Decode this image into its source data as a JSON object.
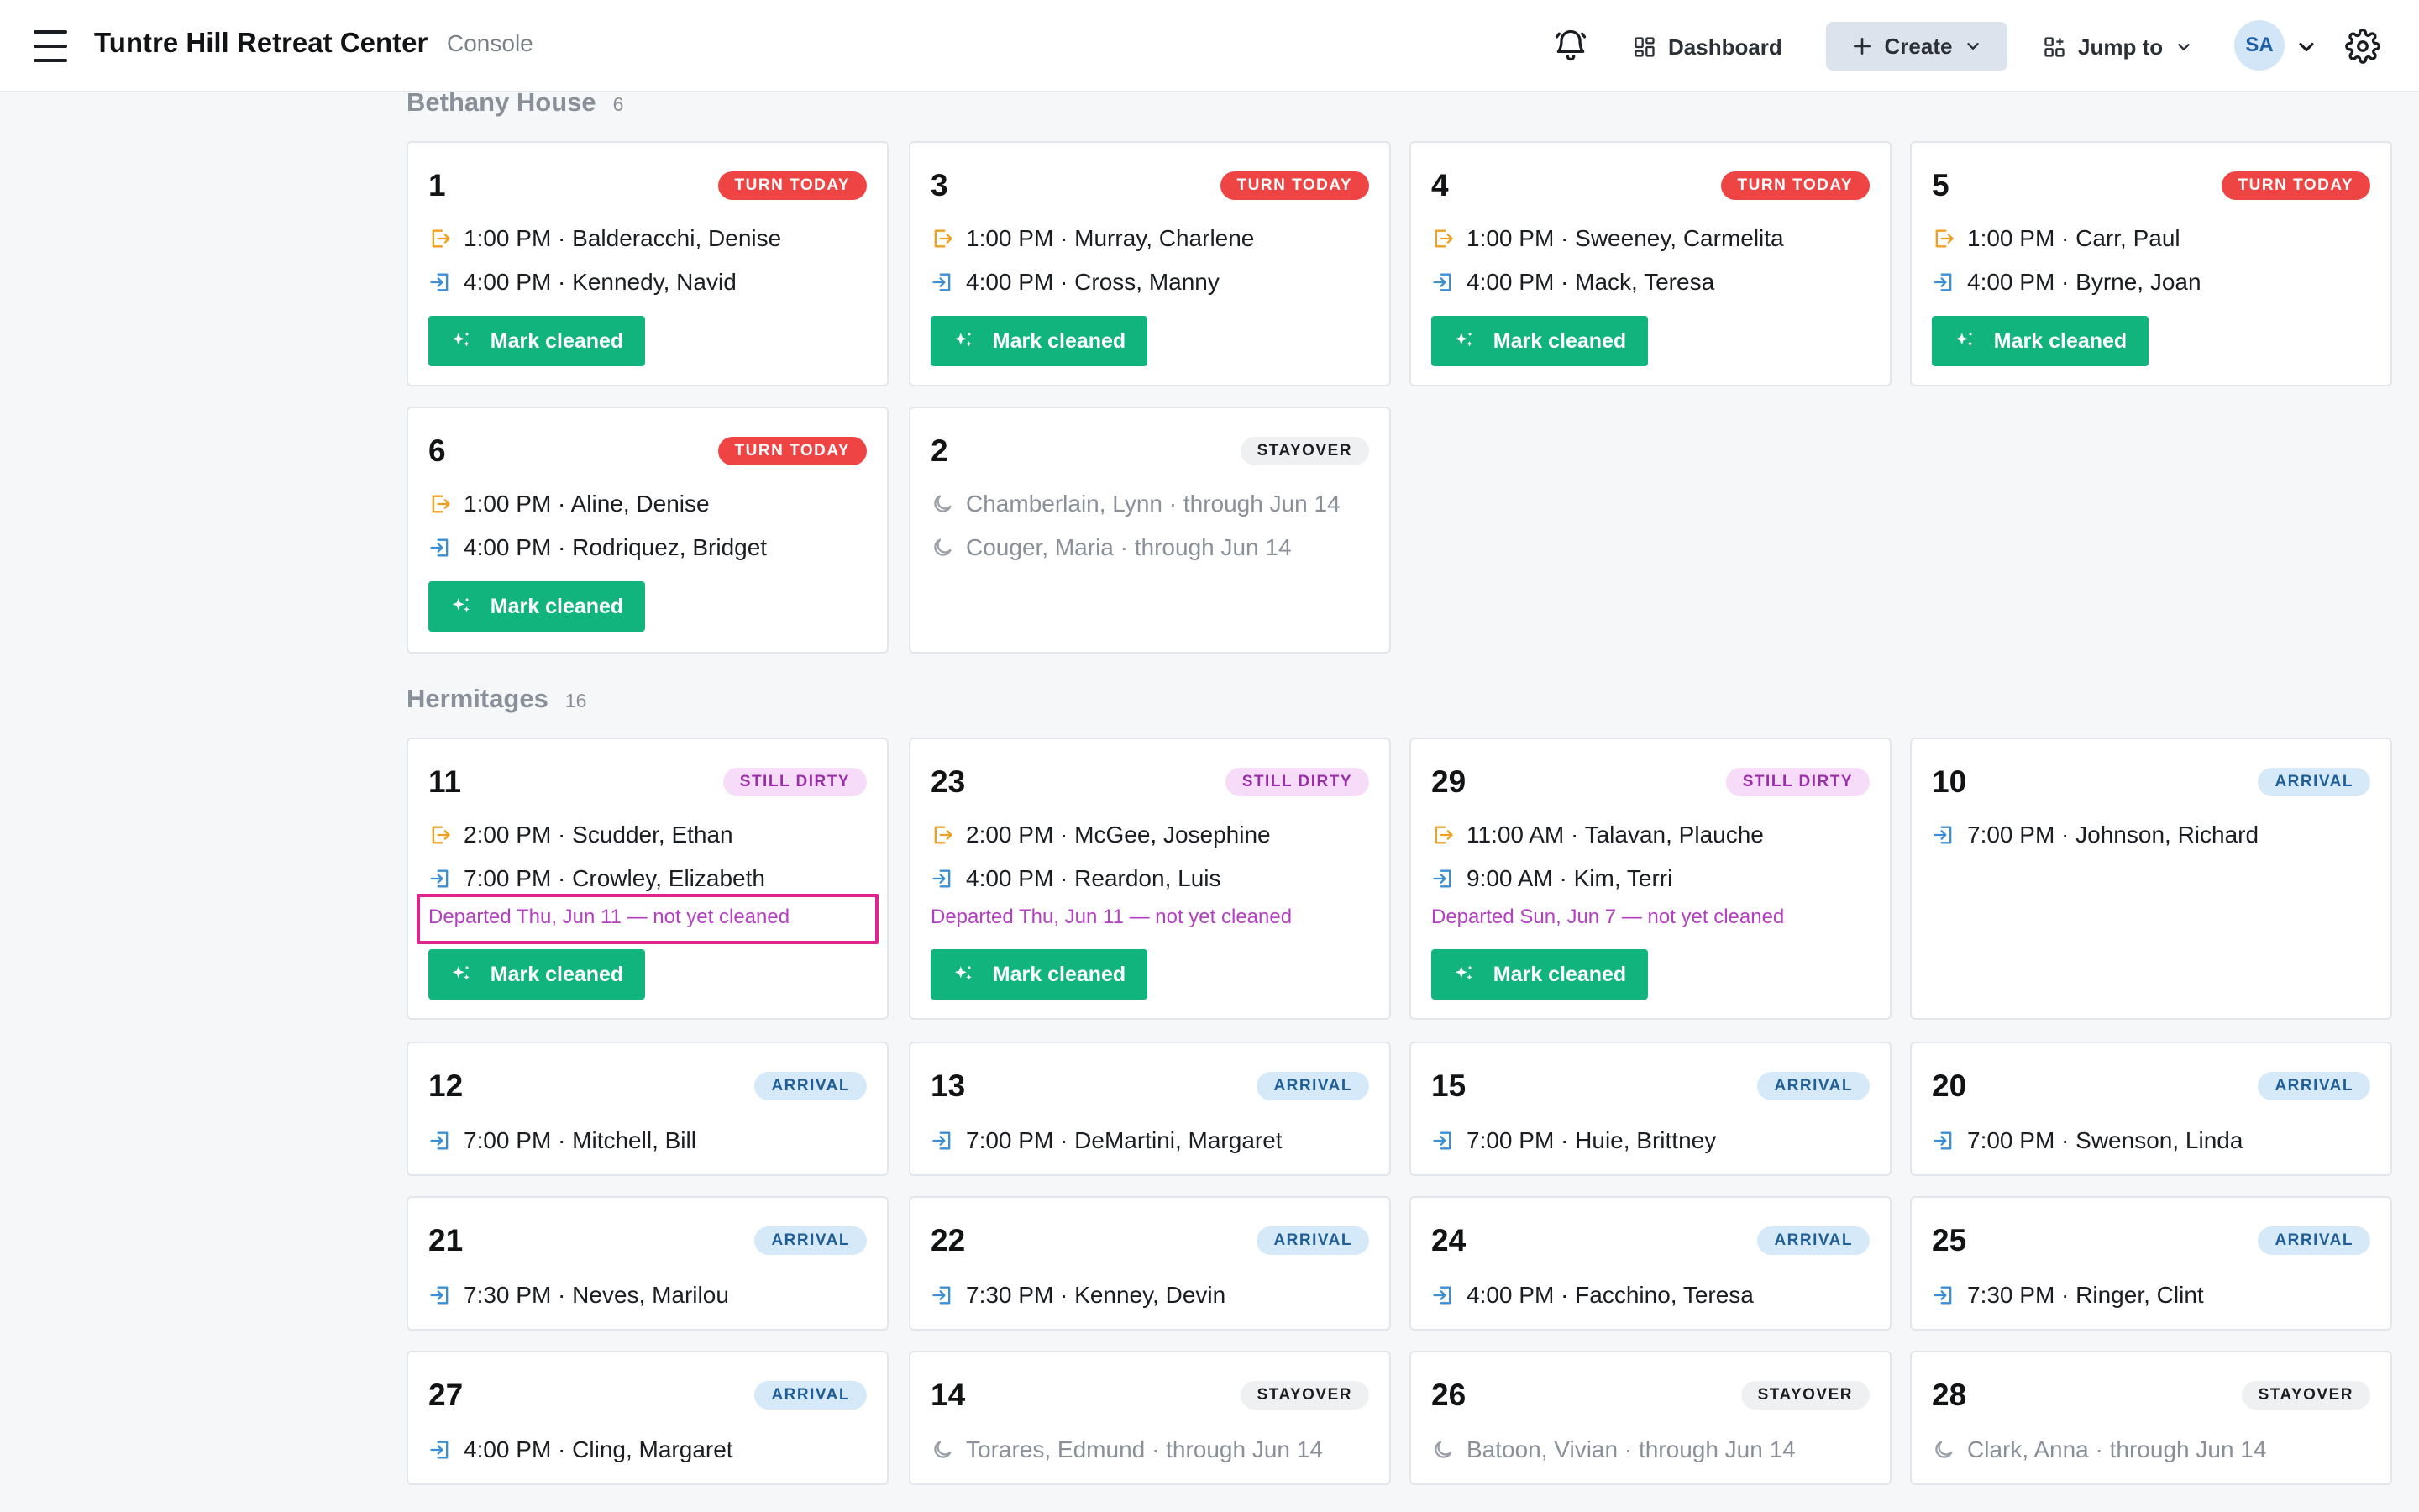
{
  "header": {
    "app_title": "Tuntre Hill Retreat Center",
    "app_subtitle": "Console",
    "dashboard_label": "Dashboard",
    "create_label": "Create",
    "jump_label": "Jump to",
    "avatar_initials": "SA"
  },
  "icons": {
    "menu": "hamburger-menu-icon",
    "bell": "bell-icon",
    "dashboard": "dashboard-grid-icon",
    "create": "plus-icon",
    "jump": "jump-grid-icon",
    "gear": "gear-icon",
    "checkout": "checkout-arrow-icon",
    "checkin": "checkin-arrow-icon",
    "stayover": "moon-icon",
    "clean": "sparkle-icon"
  },
  "colors": {
    "turn_today": "#ef4444",
    "still_dirty": "#9a2ea8",
    "arrival": "#1f5e97",
    "mark_cleaned": "#12b47e",
    "checkout_icon": "#f0a020",
    "checkin_icon": "#3a8fd6",
    "highlight": "#e0258f"
  },
  "sections": [
    {
      "title": "Bethany House",
      "count": "6",
      "rooms": [
        {
          "num": "1",
          "badge": "TURN TODAY",
          "status": "turn",
          "lines": [
            {
              "icon": "out",
              "text": "1:00 PM · Balderacchi, Denise"
            },
            {
              "icon": "in",
              "text": "4:00 PM · Kennedy, Navid"
            }
          ],
          "button": "Mark cleaned"
        },
        {
          "num": "3",
          "badge": "TURN TODAY",
          "status": "turn",
          "lines": [
            {
              "icon": "out",
              "text": "1:00 PM · Murray, Charlene"
            },
            {
              "icon": "in",
              "text": "4:00 PM · Cross, Manny"
            }
          ],
          "button": "Mark cleaned"
        },
        {
          "num": "4",
          "badge": "TURN TODAY",
          "status": "turn",
          "lines": [
            {
              "icon": "out",
              "text": "1:00 PM · Sweeney, Carmelita"
            },
            {
              "icon": "in",
              "text": "4:00 PM · Mack, Teresa"
            }
          ],
          "button": "Mark cleaned"
        },
        {
          "num": "5",
          "badge": "TURN TODAY",
          "status": "turn",
          "lines": [
            {
              "icon": "out",
              "text": "1:00 PM · Carr, Paul"
            },
            {
              "icon": "in",
              "text": "4:00 PM · Byrne, Joan"
            }
          ],
          "button": "Mark cleaned"
        },
        {
          "num": "6",
          "badge": "TURN TODAY",
          "status": "turn",
          "lines": [
            {
              "icon": "out",
              "text": "1:00 PM · Aline, Denise"
            },
            {
              "icon": "in",
              "text": "4:00 PM · Rodriquez, Bridget"
            }
          ],
          "button": "Mark cleaned"
        },
        {
          "num": "2",
          "badge": "STAYOVER",
          "status": "stay",
          "lines": [
            {
              "icon": "moon",
              "text": "Chamberlain, Lynn · through Jun 14"
            },
            {
              "icon": "moon",
              "text": "Couger, Maria · through Jun 14"
            }
          ]
        }
      ]
    },
    {
      "title": "Hermitages",
      "count": "16",
      "rooms": [
        {
          "num": "11",
          "badge": "STILL DIRTY",
          "status": "dirty",
          "lines": [
            {
              "icon": "out",
              "text": "2:00 PM · Scudder, Ethan"
            },
            {
              "icon": "in",
              "text": "7:00 PM · Crowley, Elizabeth"
            }
          ],
          "note": "Departed Thu, Jun 11 — not yet cleaned",
          "highlighted": true,
          "button": "Mark cleaned"
        },
        {
          "num": "23",
          "badge": "STILL DIRTY",
          "status": "dirty",
          "lines": [
            {
              "icon": "out",
              "text": "2:00 PM · McGee, Josephine"
            },
            {
              "icon": "in",
              "text": "4:00 PM · Reardon, Luis"
            }
          ],
          "note": "Departed Thu, Jun 11 — not yet cleaned",
          "button": "Mark cleaned"
        },
        {
          "num": "29",
          "badge": "STILL DIRTY",
          "status": "dirty",
          "lines": [
            {
              "icon": "out",
              "text": "11:00 AM · Talavan, Plauche"
            },
            {
              "icon": "in",
              "text": "9:00 AM · Kim, Terri"
            }
          ],
          "note": "Departed Sun, Jun 7 — not yet cleaned",
          "button": "Mark cleaned"
        },
        {
          "num": "10",
          "badge": "ARRIVAL",
          "status": "arr",
          "lines": [
            {
              "icon": "in",
              "text": "7:00 PM · Johnson, Richard"
            }
          ]
        },
        {
          "num": "12",
          "badge": "ARRIVAL",
          "status": "arr",
          "lines": [
            {
              "icon": "in",
              "text": "7:00 PM · Mitchell, Bill"
            }
          ]
        },
        {
          "num": "13",
          "badge": "ARRIVAL",
          "status": "arr",
          "lines": [
            {
              "icon": "in",
              "text": "7:00 PM · DeMartini, Margaret"
            }
          ]
        },
        {
          "num": "15",
          "badge": "ARRIVAL",
          "status": "arr",
          "lines": [
            {
              "icon": "in",
              "text": "7:00 PM · Huie, Brittney"
            }
          ]
        },
        {
          "num": "20",
          "badge": "ARRIVAL",
          "status": "arr",
          "lines": [
            {
              "icon": "in",
              "text": "7:00 PM · Swenson, Linda"
            }
          ]
        },
        {
          "num": "21",
          "badge": "ARRIVAL",
          "status": "arr",
          "lines": [
            {
              "icon": "in",
              "text": "7:30 PM · Neves, Marilou"
            }
          ]
        },
        {
          "num": "22",
          "badge": "ARRIVAL",
          "status": "arr",
          "lines": [
            {
              "icon": "in",
              "text": "7:30 PM · Kenney, Devin"
            }
          ]
        },
        {
          "num": "24",
          "badge": "ARRIVAL",
          "status": "arr",
          "lines": [
            {
              "icon": "in",
              "text": "4:00 PM · Facchino, Teresa"
            }
          ]
        },
        {
          "num": "25",
          "badge": "ARRIVAL",
          "status": "arr",
          "lines": [
            {
              "icon": "in",
              "text": "7:30 PM · Ringer, Clint"
            }
          ]
        },
        {
          "num": "27",
          "badge": "ARRIVAL",
          "status": "arr",
          "lines": [
            {
              "icon": "in",
              "text": "4:00 PM · Cling, Margaret"
            }
          ]
        },
        {
          "num": "14",
          "badge": "STAYOVER",
          "status": "stay",
          "lines": [
            {
              "icon": "moon",
              "text": "Torares, Edmund · through Jun 14"
            }
          ]
        },
        {
          "num": "26",
          "badge": "STAYOVER",
          "status": "stay",
          "lines": [
            {
              "icon": "moon",
              "text": "Batoon, Vivian · through Jun 14"
            }
          ]
        },
        {
          "num": "28",
          "badge": "STAYOVER",
          "status": "stay",
          "lines": [
            {
              "icon": "moon",
              "text": "Clark, Anna · through Jun 14"
            }
          ]
        }
      ]
    }
  ]
}
